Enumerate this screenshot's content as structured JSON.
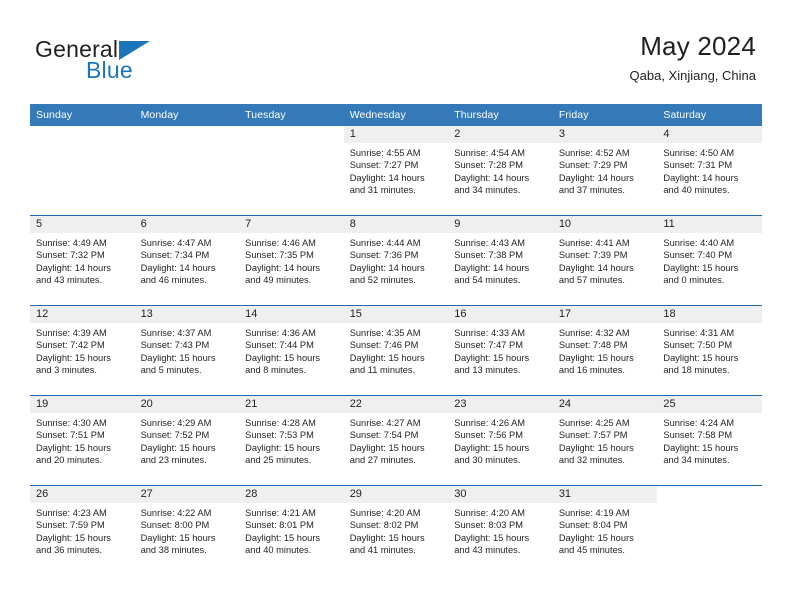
{
  "brand": {
    "name_part1": "General",
    "name_part2": "Blue",
    "logo_icon": "blue-triangle-icon"
  },
  "header": {
    "title": "May 2024",
    "subtitle": "Qaba, Xinjiang, China"
  },
  "colors": {
    "header_blue": "#357ab8",
    "rule_blue": "#1d6aad",
    "brand_blue": "#1b75bb",
    "daynum_band": "#efefef",
    "text": "#231f20"
  },
  "weekdays": [
    "Sunday",
    "Monday",
    "Tuesday",
    "Wednesday",
    "Thursday",
    "Friday",
    "Saturday"
  ],
  "weeks": [
    [
      {
        "day": "",
        "blank": true,
        "lines": []
      },
      {
        "day": "",
        "blank": true,
        "lines": []
      },
      {
        "day": "",
        "blank": true,
        "lines": []
      },
      {
        "day": "1",
        "lines": [
          "Sunrise: 4:55 AM",
          "Sunset: 7:27 PM",
          "Daylight: 14 hours",
          "and 31 minutes."
        ]
      },
      {
        "day": "2",
        "lines": [
          "Sunrise: 4:54 AM",
          "Sunset: 7:28 PM",
          "Daylight: 14 hours",
          "and 34 minutes."
        ]
      },
      {
        "day": "3",
        "lines": [
          "Sunrise: 4:52 AM",
          "Sunset: 7:29 PM",
          "Daylight: 14 hours",
          "and 37 minutes."
        ]
      },
      {
        "day": "4",
        "lines": [
          "Sunrise: 4:50 AM",
          "Sunset: 7:31 PM",
          "Daylight: 14 hours",
          "and 40 minutes."
        ]
      }
    ],
    [
      {
        "day": "5",
        "lines": [
          "Sunrise: 4:49 AM",
          "Sunset: 7:32 PM",
          "Daylight: 14 hours",
          "and 43 minutes."
        ]
      },
      {
        "day": "6",
        "lines": [
          "Sunrise: 4:47 AM",
          "Sunset: 7:34 PM",
          "Daylight: 14 hours",
          "and 46 minutes."
        ]
      },
      {
        "day": "7",
        "lines": [
          "Sunrise: 4:46 AM",
          "Sunset: 7:35 PM",
          "Daylight: 14 hours",
          "and 49 minutes."
        ]
      },
      {
        "day": "8",
        "lines": [
          "Sunrise: 4:44 AM",
          "Sunset: 7:36 PM",
          "Daylight: 14 hours",
          "and 52 minutes."
        ]
      },
      {
        "day": "9",
        "lines": [
          "Sunrise: 4:43 AM",
          "Sunset: 7:38 PM",
          "Daylight: 14 hours",
          "and 54 minutes."
        ]
      },
      {
        "day": "10",
        "lines": [
          "Sunrise: 4:41 AM",
          "Sunset: 7:39 PM",
          "Daylight: 14 hours",
          "and 57 minutes."
        ]
      },
      {
        "day": "11",
        "lines": [
          "Sunrise: 4:40 AM",
          "Sunset: 7:40 PM",
          "Daylight: 15 hours",
          "and 0 minutes."
        ]
      }
    ],
    [
      {
        "day": "12",
        "lines": [
          "Sunrise: 4:39 AM",
          "Sunset: 7:42 PM",
          "Daylight: 15 hours",
          "and 3 minutes."
        ]
      },
      {
        "day": "13",
        "lines": [
          "Sunrise: 4:37 AM",
          "Sunset: 7:43 PM",
          "Daylight: 15 hours",
          "and 5 minutes."
        ]
      },
      {
        "day": "14",
        "lines": [
          "Sunrise: 4:36 AM",
          "Sunset: 7:44 PM",
          "Daylight: 15 hours",
          "and 8 minutes."
        ]
      },
      {
        "day": "15",
        "lines": [
          "Sunrise: 4:35 AM",
          "Sunset: 7:46 PM",
          "Daylight: 15 hours",
          "and 11 minutes."
        ]
      },
      {
        "day": "16",
        "lines": [
          "Sunrise: 4:33 AM",
          "Sunset: 7:47 PM",
          "Daylight: 15 hours",
          "and 13 minutes."
        ]
      },
      {
        "day": "17",
        "lines": [
          "Sunrise: 4:32 AM",
          "Sunset: 7:48 PM",
          "Daylight: 15 hours",
          "and 16 minutes."
        ]
      },
      {
        "day": "18",
        "lines": [
          "Sunrise: 4:31 AM",
          "Sunset: 7:50 PM",
          "Daylight: 15 hours",
          "and 18 minutes."
        ]
      }
    ],
    [
      {
        "day": "19",
        "lines": [
          "Sunrise: 4:30 AM",
          "Sunset: 7:51 PM",
          "Daylight: 15 hours",
          "and 20 minutes."
        ]
      },
      {
        "day": "20",
        "lines": [
          "Sunrise: 4:29 AM",
          "Sunset: 7:52 PM",
          "Daylight: 15 hours",
          "and 23 minutes."
        ]
      },
      {
        "day": "21",
        "lines": [
          "Sunrise: 4:28 AM",
          "Sunset: 7:53 PM",
          "Daylight: 15 hours",
          "and 25 minutes."
        ]
      },
      {
        "day": "22",
        "lines": [
          "Sunrise: 4:27 AM",
          "Sunset: 7:54 PM",
          "Daylight: 15 hours",
          "and 27 minutes."
        ]
      },
      {
        "day": "23",
        "lines": [
          "Sunrise: 4:26 AM",
          "Sunset: 7:56 PM",
          "Daylight: 15 hours",
          "and 30 minutes."
        ]
      },
      {
        "day": "24",
        "lines": [
          "Sunrise: 4:25 AM",
          "Sunset: 7:57 PM",
          "Daylight: 15 hours",
          "and 32 minutes."
        ]
      },
      {
        "day": "25",
        "lines": [
          "Sunrise: 4:24 AM",
          "Sunset: 7:58 PM",
          "Daylight: 15 hours",
          "and 34 minutes."
        ]
      }
    ],
    [
      {
        "day": "26",
        "lines": [
          "Sunrise: 4:23 AM",
          "Sunset: 7:59 PM",
          "Daylight: 15 hours",
          "and 36 minutes."
        ]
      },
      {
        "day": "27",
        "lines": [
          "Sunrise: 4:22 AM",
          "Sunset: 8:00 PM",
          "Daylight: 15 hours",
          "and 38 minutes."
        ]
      },
      {
        "day": "28",
        "lines": [
          "Sunrise: 4:21 AM",
          "Sunset: 8:01 PM",
          "Daylight: 15 hours",
          "and 40 minutes."
        ]
      },
      {
        "day": "29",
        "lines": [
          "Sunrise: 4:20 AM",
          "Sunset: 8:02 PM",
          "Daylight: 15 hours",
          "and 41 minutes."
        ]
      },
      {
        "day": "30",
        "lines": [
          "Sunrise: 4:20 AM",
          "Sunset: 8:03 PM",
          "Daylight: 15 hours",
          "and 43 minutes."
        ]
      },
      {
        "day": "31",
        "lines": [
          "Sunrise: 4:19 AM",
          "Sunset: 8:04 PM",
          "Daylight: 15 hours",
          "and 45 minutes."
        ]
      },
      {
        "day": "",
        "blank": true,
        "lines": []
      }
    ]
  ]
}
